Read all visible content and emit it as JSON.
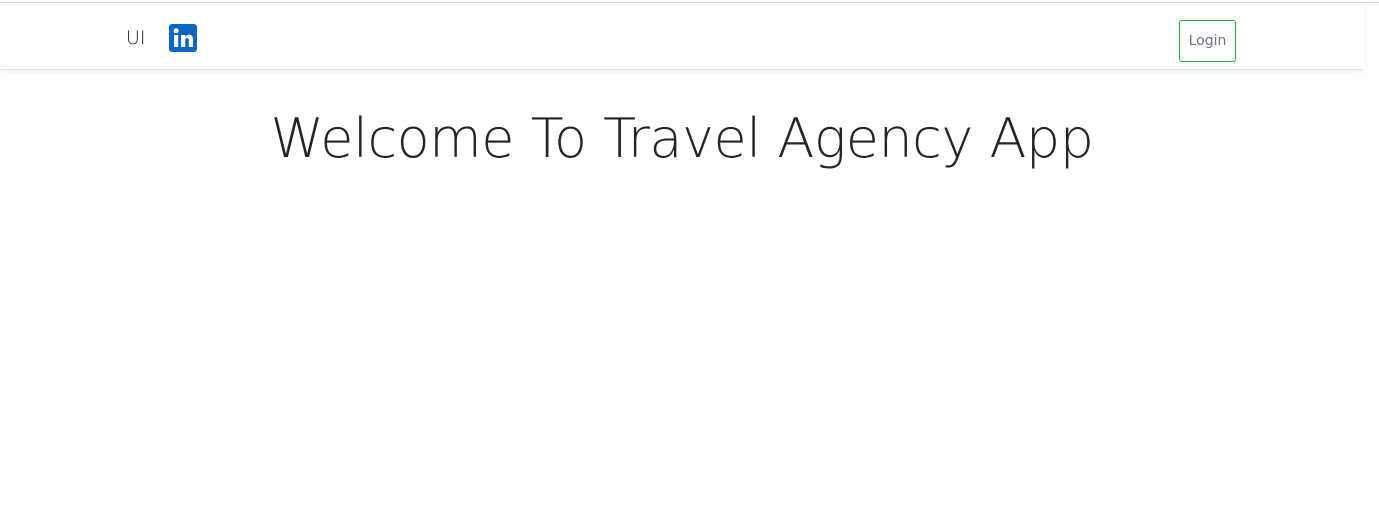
{
  "navbar": {
    "brand_text": "UI",
    "linkedin_icon": "linkedin-icon",
    "login_label": "Login"
  },
  "main": {
    "heading": "Welcome To Travel Agency App"
  },
  "colors": {
    "linkedin_blue": "#0a66c2",
    "login_border": "#28a745",
    "text": "#212529"
  }
}
